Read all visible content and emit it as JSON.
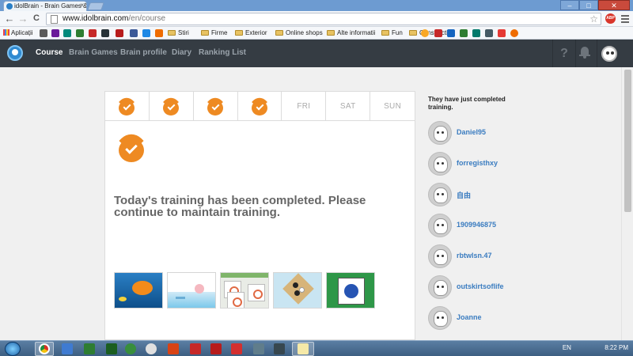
{
  "browser": {
    "tab_title": "idolBrain - Brain Games &",
    "tab_close": "×",
    "url_host": "www.idolbrain.com",
    "url_path": "/en/course",
    "nav_back": "←",
    "nav_forward": "→",
    "nav_reload": "C",
    "star": "☆",
    "abp_label": "ABP",
    "window_buttons": {
      "minimize": "–",
      "maximize": "□",
      "close": "✕"
    }
  },
  "bookmarks": {
    "apps_label": "Aplicații",
    "folders": [
      "Stiri",
      "Firme",
      "Exterior",
      "Online shops",
      "Alte informatii",
      "Fun",
      "Constructii"
    ]
  },
  "site": {
    "nav": [
      {
        "label": "Course",
        "active": true
      },
      {
        "label": "Brain Games",
        "active": false
      },
      {
        "label": "Brain profile",
        "active": false
      },
      {
        "label": "Diary",
        "active": false
      },
      {
        "label": "Ranking List",
        "active": false
      }
    ],
    "help_label": "?",
    "week": {
      "completed_days": 4,
      "remaining_days": [
        "FRI",
        "SAT",
        "SUN"
      ]
    },
    "message": "Today's training has been completed. Please continue to maintain training.",
    "game_thumbnails": [
      "fish-game",
      "drop-game",
      "tile-game",
      "go-game",
      "card-game"
    ],
    "sidebar": {
      "title": "They have just completed training.",
      "users": [
        "Daniel95",
        "forregisthxy",
        "自由",
        "1909946875",
        "rbtwlsn.47",
        "outskirtsoflife",
        "Joanne"
      ]
    },
    "colors": {
      "accent": "#ee8a22",
      "nav_bg": "#353c43",
      "link": "#3a7cc0"
    }
  },
  "taskbar": {
    "language": "EN",
    "time": "8:22 PM"
  }
}
